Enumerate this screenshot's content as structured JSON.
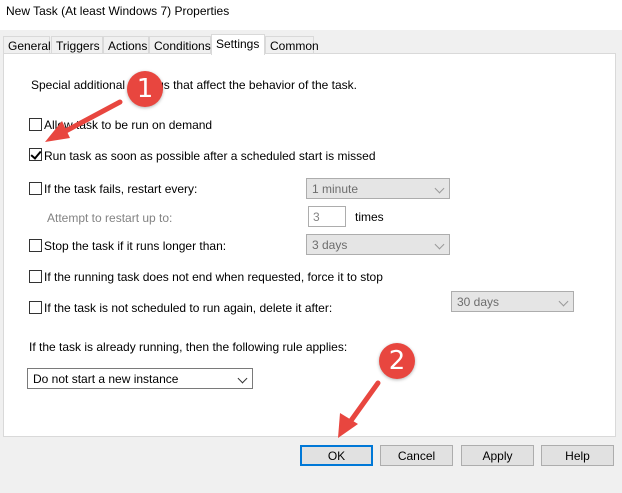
{
  "window": {
    "title": "New Task (At least Windows 7) Properties"
  },
  "tabs": [
    {
      "label": "General"
    },
    {
      "label": "Triggers"
    },
    {
      "label": "Actions"
    },
    {
      "label": "Conditions"
    },
    {
      "label": "Settings"
    },
    {
      "label": "Common"
    }
  ],
  "active_tab": "Settings",
  "settings": {
    "description": "Special additional settings that affect the behavior of the task.",
    "allow_on_demand": {
      "label": "Allow task to be run on demand",
      "checked": false
    },
    "run_asap": {
      "label": "Run task as soon as possible after a scheduled start is missed",
      "checked": true
    },
    "restart_on_fail": {
      "label": "If the task fails, restart every:",
      "checked": false,
      "value": "1 minute"
    },
    "restart_attempts": {
      "label": "Attempt to restart up to:",
      "value": "3",
      "unit": "times"
    },
    "stop_if_longer": {
      "label": "Stop the task if it runs longer than:",
      "checked": false,
      "value": "3 days"
    },
    "force_stop": {
      "label": "If the running task does not end when requested, force it to stop",
      "checked": false
    },
    "delete_after": {
      "label": "If the task is not scheduled to run again, delete it after:",
      "checked": false,
      "value": "30 days"
    },
    "running_rule_label": "If the task is already running, then the following rule applies:",
    "running_rule_value": "Do not start a new instance"
  },
  "buttons": {
    "ok": "OK",
    "cancel": "Cancel",
    "apply": "Apply",
    "help": "Help"
  },
  "annotations": [
    {
      "number": "1"
    },
    {
      "number": "2"
    }
  ],
  "colors": {
    "annotation": "#e8463f",
    "default_button_border": "#0078d7"
  }
}
